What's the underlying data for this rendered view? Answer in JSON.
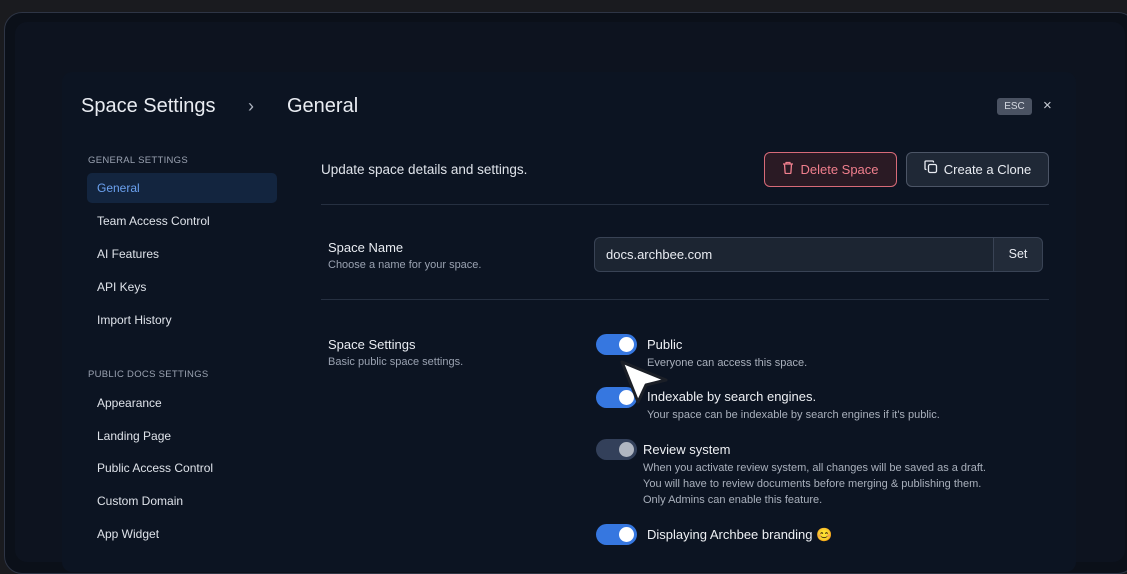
{
  "header": {
    "breadcrumb_root": "Space Settings",
    "breadcrumb_separator": "›",
    "breadcrumb_current": "General",
    "esc_label": "ESC",
    "close_glyph": "×"
  },
  "sidebar": {
    "general_heading": "GENERAL SETTINGS",
    "general_items": [
      {
        "label": "General",
        "active": true
      },
      {
        "label": "Team Access Control"
      },
      {
        "label": "AI Features"
      },
      {
        "label": "API Keys"
      },
      {
        "label": "Import History"
      }
    ],
    "public_heading": "PUBLIC DOCS SETTINGS",
    "public_items": [
      {
        "label": "Appearance"
      },
      {
        "label": "Landing Page"
      },
      {
        "label": "Public Access Control"
      },
      {
        "label": "Custom Domain"
      },
      {
        "label": "App Widget"
      }
    ]
  },
  "main": {
    "description": "Update space details and settings.",
    "delete_label": "Delete Space",
    "clone_label": "Create a Clone",
    "space_name": {
      "label": "Space Name",
      "sublabel": "Choose a name for your space.",
      "value": "docs.archbee.com",
      "set_label": "Set"
    },
    "space_settings": {
      "label": "Space Settings",
      "sublabel": "Basic public space settings.",
      "options": [
        {
          "title": "Public",
          "desc": [
            "Everyone can access this space."
          ],
          "enabled": true
        },
        {
          "title": "Indexable by search engines.",
          "desc": [
            "Your space can be indexable by search engines if it's public."
          ],
          "enabled": true
        },
        {
          "title": "Review system",
          "desc": [
            "When you activate review system, all changes will be saved as a draft.",
            "You will have to review documents before merging & publishing them.",
            "Only Admins can enable this feature."
          ],
          "enabled": false
        },
        {
          "title": "Displaying Archbee branding 😊",
          "desc": [],
          "enabled": true
        }
      ]
    }
  },
  "icons": {
    "delete": "trash-icon",
    "clone": "copy-icon",
    "pointer": "mouse-cursor-icon"
  },
  "colors": {
    "accent": "#3677e0",
    "danger": "#f07f8d",
    "active_nav_text": "#6ba1ef"
  }
}
